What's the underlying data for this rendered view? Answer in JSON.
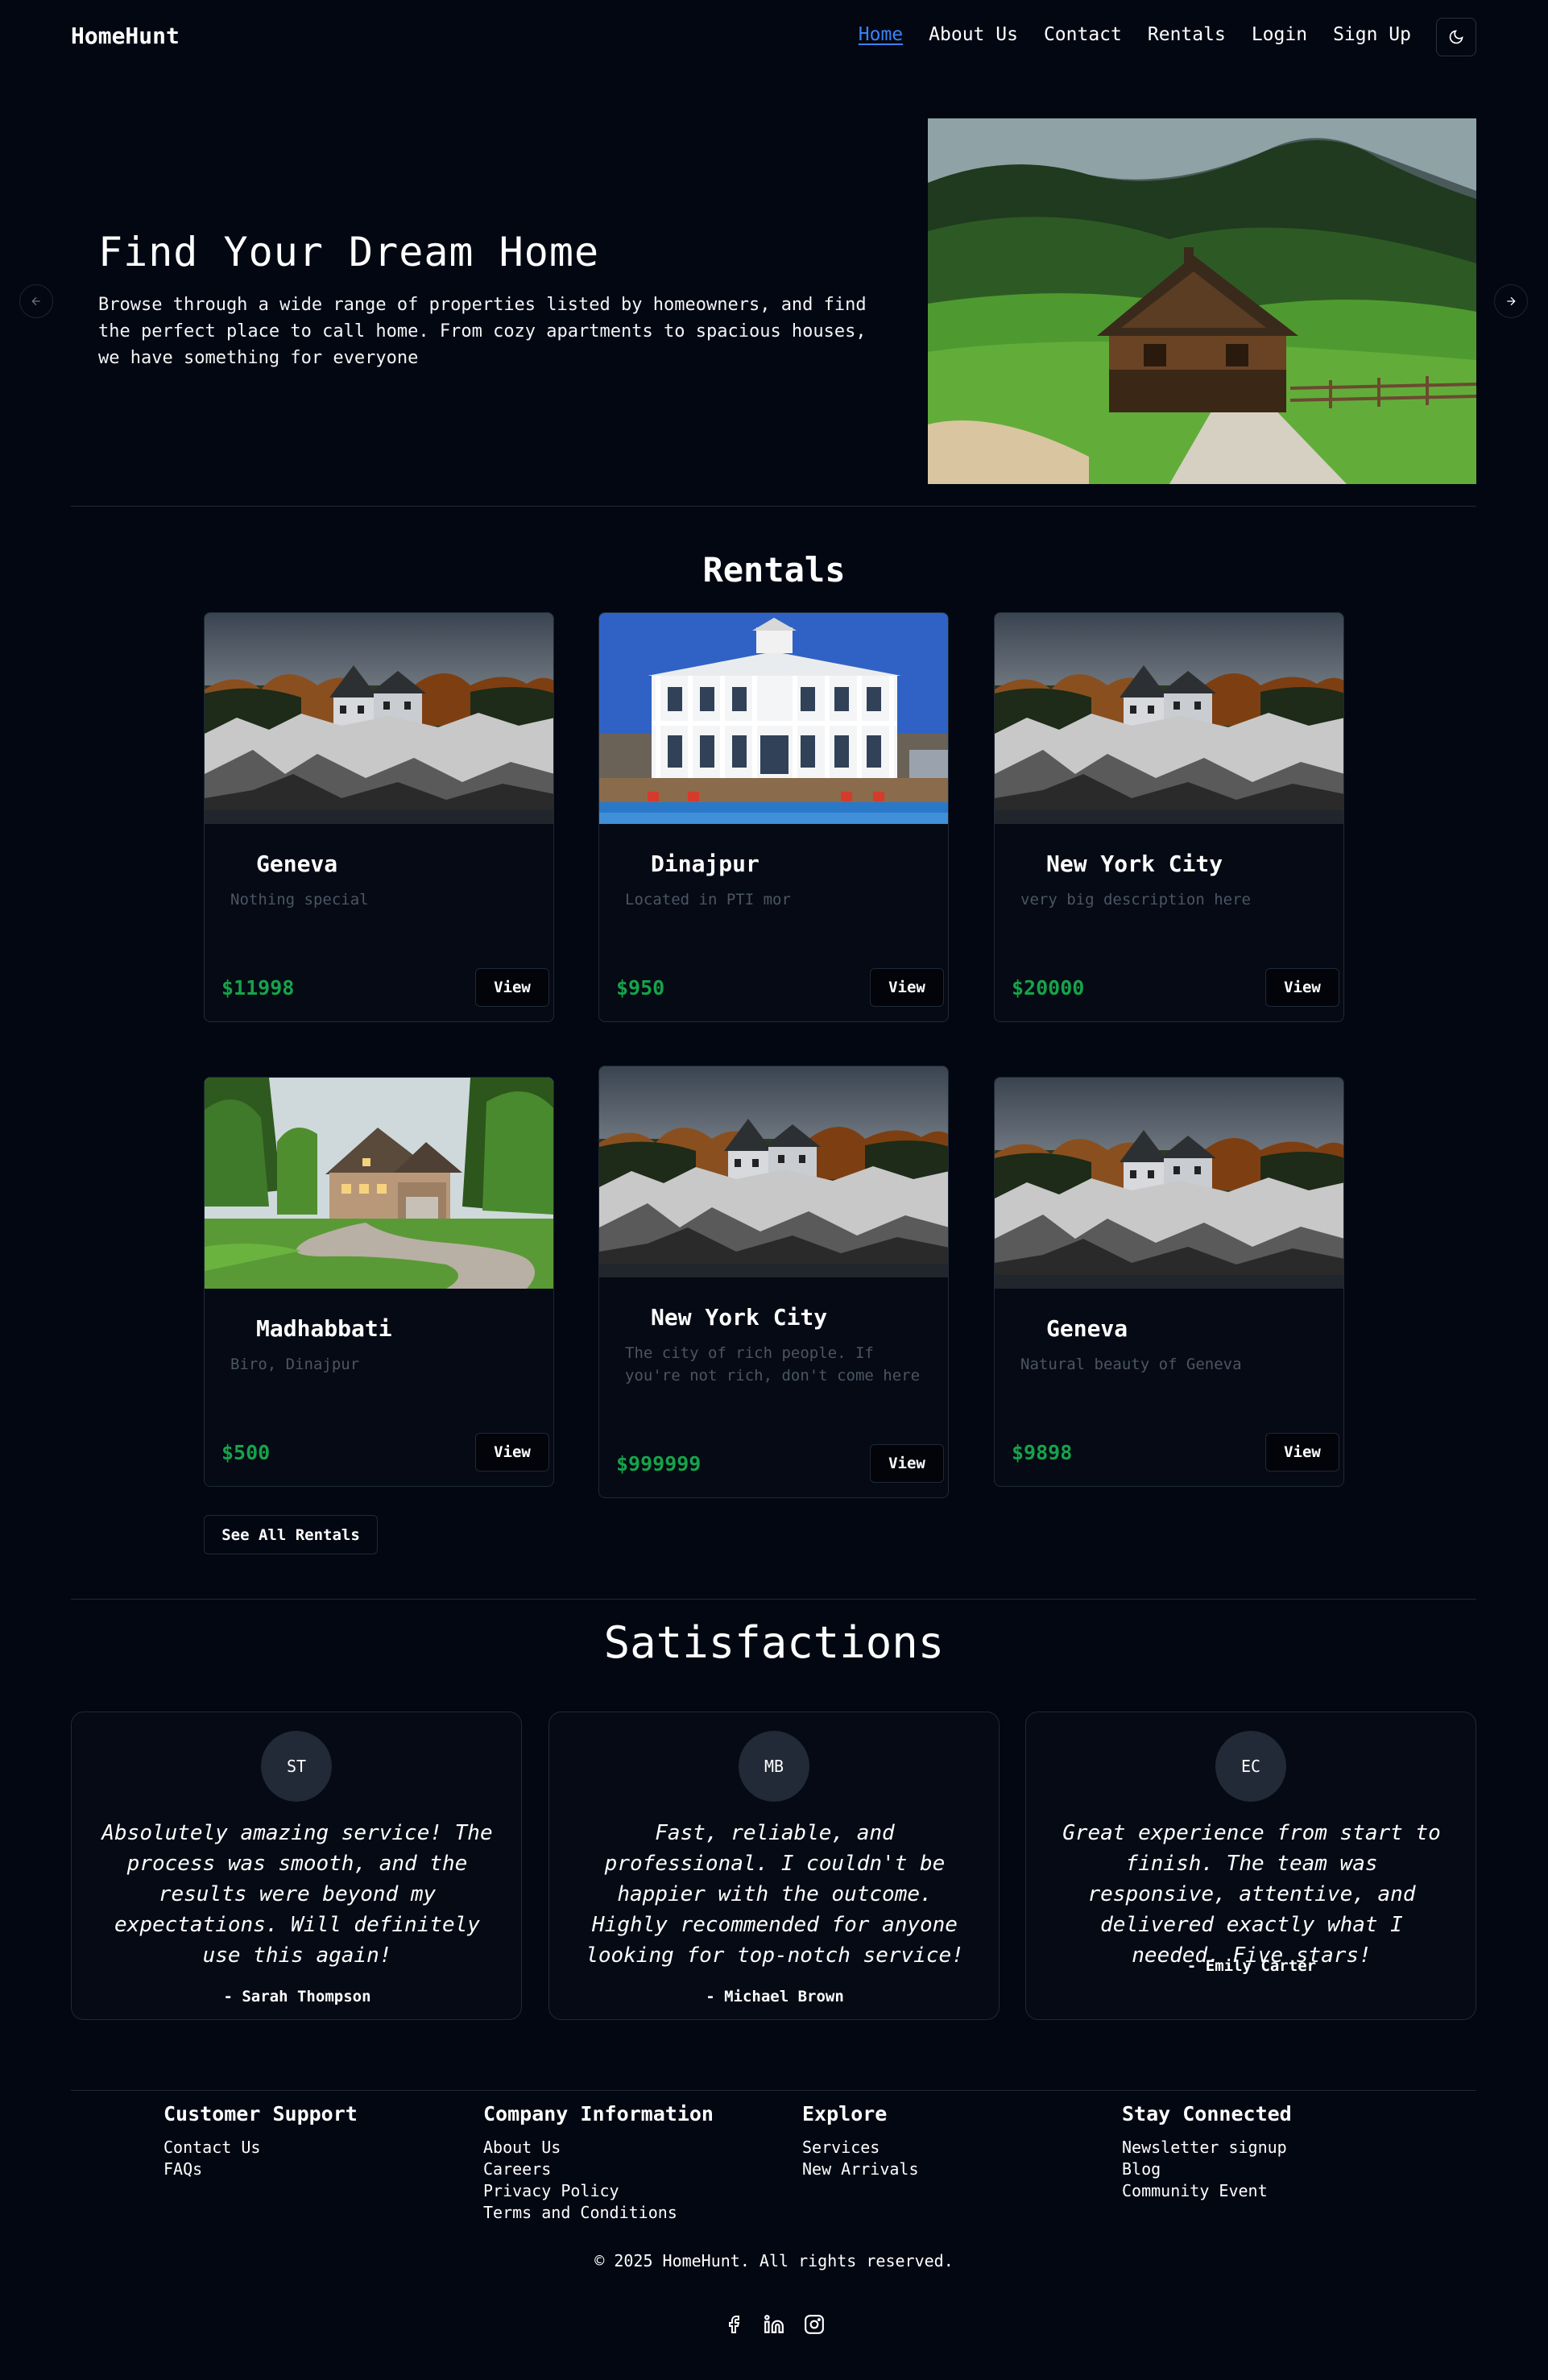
{
  "header": {
    "brand": "HomeHunt",
    "nav": [
      "Home",
      "About Us",
      "Contact",
      "Rentals",
      "Login",
      "Sign Up"
    ],
    "active": "Home",
    "theme_icon": "moon-icon"
  },
  "hero": {
    "title": "Find Your Dream Home",
    "description": "Browse through a wide range of properties listed by homeowners, and find the perfect place to call home. From cozy apartments to spacious houses, we have something for everyone",
    "image": "mountain-cabin-photo"
  },
  "rentals": {
    "title": "Rentals",
    "view_label": "View",
    "see_all_label": "See All Rentals",
    "items": [
      {
        "title": "Geneva",
        "description": "Nothing special",
        "price": "$11998",
        "image": "lakeside-house-photo"
      },
      {
        "title": "Dinajpur",
        "description": "Located in PTI mor",
        "price": "$950",
        "image": "white-mansion-photo"
      },
      {
        "title": "New York City",
        "description": "very big description here",
        "price": "$20000",
        "image": "lakeside-house-photo"
      },
      {
        "title": "Madhabbati",
        "description": "Biro, Dinajpur",
        "price": "$500",
        "image": "suburban-house-photo"
      },
      {
        "title": "New York City",
        "description": "The city of rich people. If you're not rich, don't come here",
        "price": "$999999",
        "image": "lakeside-house-photo"
      },
      {
        "title": "Geneva",
        "description": "Natural beauty of Geneva",
        "price": "$9898",
        "image": "lakeside-house-photo"
      }
    ]
  },
  "satisfactions": {
    "title": "Satisfactions",
    "items": [
      {
        "initials": "ST",
        "quote": "Absolutely amazing service! The process was smooth, and the results were beyond my expectations. Will definitely use this again!",
        "author": "- Sarah Thompson"
      },
      {
        "initials": "MB",
        "quote": "Fast, reliable, and professional. I couldn't be happier with the outcome. Highly recommended for anyone looking for top-notch service!",
        "author": "- Michael Brown"
      },
      {
        "initials": "EC",
        "quote": "Great experience from start to finish. The team was responsive, attentive, and delivered exactly what I needed. Five stars!",
        "author": "- Emily Carter"
      }
    ]
  },
  "footer": {
    "columns": [
      {
        "title": "Customer Support",
        "links": [
          "Contact Us",
          "FAQs"
        ]
      },
      {
        "title": "Company Information",
        "links": [
          "About Us",
          "Careers",
          "Privacy Policy",
          "Terms and Conditions"
        ]
      },
      {
        "title": "Explore",
        "links": [
          "Services",
          "New Arrivals"
        ]
      },
      {
        "title": "Stay Connected",
        "links": [
          "Newsletter signup",
          "Blog",
          "Community Event"
        ]
      }
    ],
    "copyright": "© 2025 HomeHunt. All rights reserved.",
    "socials": [
      "facebook-icon",
      "linkedin-icon",
      "instagram-icon"
    ]
  }
}
